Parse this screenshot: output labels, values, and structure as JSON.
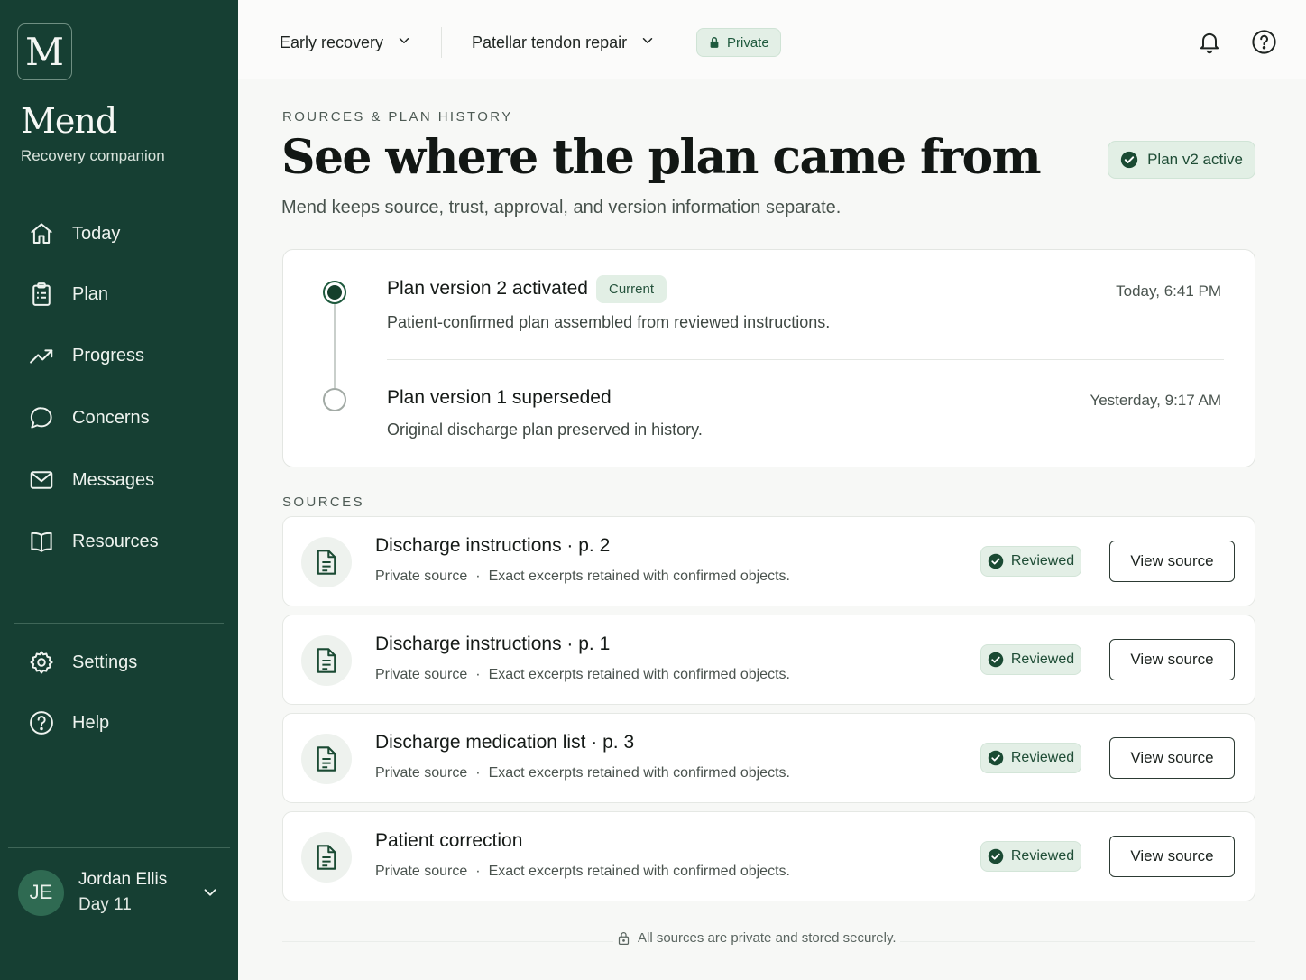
{
  "app": {
    "logo_letter": "M",
    "name": "Mend",
    "tagline": "Recovery companion"
  },
  "sidebar": {
    "items": [
      {
        "label": "Today",
        "icon": "home-icon"
      },
      {
        "label": "Plan",
        "icon": "clipboard-icon"
      },
      {
        "label": "Progress",
        "icon": "trending-up-icon"
      },
      {
        "label": "Concerns",
        "icon": "chat-bubble-icon"
      },
      {
        "label": "Messages",
        "icon": "mail-icon"
      },
      {
        "label": "Resources",
        "icon": "book-icon"
      }
    ],
    "secondary": [
      {
        "label": "Settings",
        "icon": "gear-icon"
      },
      {
        "label": "Help",
        "icon": "help-circle-icon"
      }
    ],
    "user": {
      "initials": "JE",
      "name": "Jordan Ellis",
      "day": "Day 11"
    }
  },
  "topbar": {
    "phase": "Early recovery",
    "procedure": "Patellar tendon repair",
    "privacy": "Private"
  },
  "header": {
    "eyebrow": "ROURCES & PLAN HISTORY",
    "title": "See where the plan came from",
    "subtitle": "Mend keeps source, trust, approval, and version information separate.",
    "active_plan": "Plan v2 active"
  },
  "history": [
    {
      "title": "Plan version 2 activated",
      "chip": "Current",
      "description": "Patient-confirmed plan assembled from reviewed instructions.",
      "time": "Today, 6:41 PM"
    },
    {
      "title": "Plan version 1 superseded",
      "description": "Original discharge plan preserved in history.",
      "time": "Yesterday, 9:17 AM"
    }
  ],
  "sources_label": "SOURCES",
  "sources": [
    {
      "title": "Discharge instructions · p. 2",
      "privacy": "Private source",
      "detail": "Exact excerpts retained with confirmed objects.",
      "status": "Reviewed",
      "action": "View source"
    },
    {
      "title": "Discharge instructions · p. 1",
      "privacy": "Private source",
      "detail": "Exact excerpts retained with confirmed objects.",
      "status": "Reviewed",
      "action": "View source"
    },
    {
      "title": "Discharge medication list · p. 3",
      "privacy": "Private source",
      "detail": "Exact excerpts retained with confirmed objects.",
      "status": "Reviewed",
      "action": "View source"
    },
    {
      "title": "Patient correction",
      "privacy": "Private source",
      "detail": "Exact excerpts retained with confirmed objects.",
      "status": "Reviewed",
      "action": "View source"
    }
  ],
  "footer": {
    "note": "All sources are private and stored securely."
  },
  "colors": {
    "sidebar": "#163f33",
    "accent": "#1f5a3e",
    "badge_bg": "#e2efe5",
    "background": "#f7f8f6"
  }
}
